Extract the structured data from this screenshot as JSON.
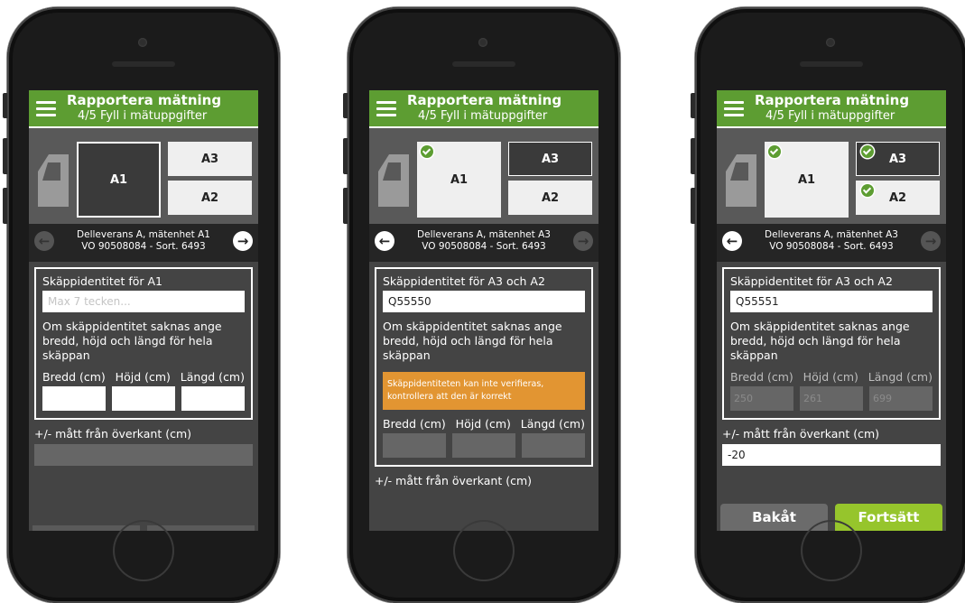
{
  "screens": [
    {
      "header": {
        "title": "Rapportera mätning",
        "subtitle": "4/5 Fyll i mätuppgifter"
      },
      "zones": {
        "a1": "A1",
        "a3": "A3",
        "a2": "A2"
      },
      "nav": {
        "line1": "Delleverans A, mätenhet A1",
        "line2": "VO 90508084 - Sort. 6493",
        "prev_arrow": "←",
        "next_arrow": "→"
      },
      "form": {
        "identity_label": "Skäppidentitet för A1",
        "identity_placeholder": "Max 7 tecken...",
        "info": "Om skäppidentitet saknas ange bredd, höjd och längd för hela skäppan",
        "width_label": "Bredd (cm)",
        "height_label": "Höjd (cm)",
        "length_label": "Längd (cm)",
        "offset_label": "+/- mått från överkant (cm)"
      }
    },
    {
      "header": {
        "title": "Rapportera mätning",
        "subtitle": "4/5 Fyll i mätuppgifter"
      },
      "zones": {
        "a1": "A1",
        "a3": "A3",
        "a2": "A2"
      },
      "nav": {
        "line1": "Delleverans A, mätenhet A3",
        "line2": "VO 90508084 - Sort. 6493",
        "prev_arrow": "←",
        "next_arrow": "→"
      },
      "form": {
        "identity_label": "Skäppidentitet för A3 och A2",
        "identity_value": "Q55550",
        "info": "Om skäppidentitet saknas ange bredd, höjd och längd för hela skäppan",
        "warning": "Skäppidentiteten kan inte verifieras, kontrollera att den är korrekt",
        "width_label": "Bredd (cm)",
        "height_label": "Höjd (cm)",
        "length_label": "Längd (cm)",
        "offset_label": "+/- mått från överkant (cm)"
      }
    },
    {
      "header": {
        "title": "Rapportera mätning",
        "subtitle": "4/5 Fyll i mätuppgifter"
      },
      "zones": {
        "a1": "A1",
        "a3": "A3",
        "a2": "A2"
      },
      "nav": {
        "line1": "Delleverans A, mätenhet A3",
        "line2": "VO 90508084 - Sort. 6493",
        "prev_arrow": "←",
        "next_arrow": "→"
      },
      "form": {
        "identity_label": "Skäppidentitet för A3 och A2",
        "identity_value": "Q55551",
        "info": "Om skäppidentitet saknas ange bredd, höjd och längd för hela skäppan",
        "width_label": "Bredd (cm)",
        "height_label": "Höjd (cm)",
        "length_label": "Längd (cm)",
        "width_value": "250",
        "height_value": "261",
        "length_value": "699",
        "offset_label": "+/- mått från överkant (cm)",
        "offset_value": "-20"
      },
      "buttons": {
        "back": "Bakåt",
        "next": "Fortsätt"
      }
    }
  ]
}
